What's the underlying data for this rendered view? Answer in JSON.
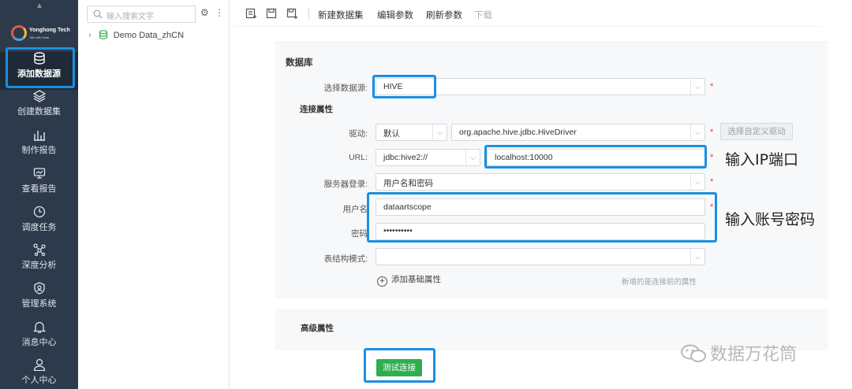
{
  "brand": {
    "name": "Yonghong Tech",
    "tagline": "Talk with Data"
  },
  "nav": {
    "items": [
      {
        "label": "添加数据源",
        "icon": "database-icon"
      },
      {
        "label": "创建数据集",
        "icon": "layers-icon"
      },
      {
        "label": "制作报告",
        "icon": "chart-icon"
      },
      {
        "label": "查看报告",
        "icon": "monitor-icon"
      },
      {
        "label": "调度任务",
        "icon": "clock-icon"
      },
      {
        "label": "深度分析",
        "icon": "network-icon"
      },
      {
        "label": "管理系统",
        "icon": "shield-icon"
      },
      {
        "label": "消息中心",
        "icon": "bell-icon"
      },
      {
        "label": "个人中心",
        "icon": "user-icon"
      }
    ]
  },
  "tree": {
    "search_placeholder": "输入搜索文字",
    "items": [
      {
        "label": "Demo Data_zhCN"
      }
    ]
  },
  "toolbar": {
    "new_dataset": "新建数据集",
    "edit_params": "编辑参数",
    "refresh_params": "刷新参数",
    "download": "下载"
  },
  "form": {
    "section_database": "数据库",
    "datasource_label": "选择数据源:",
    "datasource_value": "HIVE",
    "section_connection": "连接属性",
    "driver_label": "驱动:",
    "driver_type": "默认",
    "driver_class": "org.apache.hive.jdbc.HiveDriver",
    "custom_driver_button": "选择自定义驱动",
    "url_label": "URL:",
    "url_prefix": "jdbc:hive2://",
    "url_host": "localhost:10000",
    "login_label": "服务器登录:",
    "login_value": "用户名和密码",
    "username_label": "用户名",
    "username_value": "dataartscope",
    "password_label": "密码",
    "password_value": "••••••••••",
    "schema_label": "表结构模式:",
    "schema_value": "",
    "add_property": "添加基础属性",
    "add_property_hint": "新增的是连接前的属性",
    "section_advanced": "高级属性",
    "test_button": "测试连接",
    "required_mark": "*"
  },
  "annotations": {
    "ip_port": "输入IP端口",
    "account_password": "输入账号密码"
  },
  "watermark": "数据万花筒",
  "colors": {
    "nav_bg": "#2d3a4b",
    "highlight": "#1b8fe0",
    "test_button": "#2fae4f",
    "required": "#e04545"
  }
}
